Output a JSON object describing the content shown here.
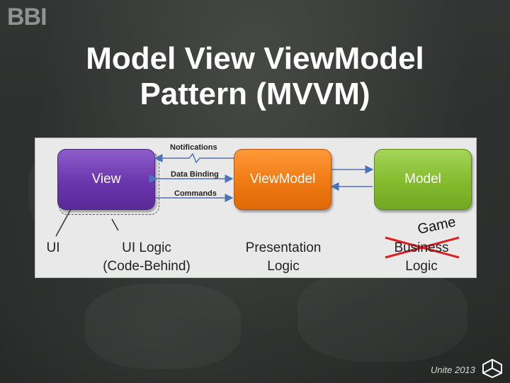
{
  "logo": {
    "text": "BBI"
  },
  "title": {
    "line1": "Model View ViewModel",
    "line2": "Pattern (MVVM)"
  },
  "diagram": {
    "boxes": {
      "view": "View",
      "viewmodel": "ViewModel",
      "model": "Model"
    },
    "arrows": {
      "notifications": "Notifications",
      "data_binding": "Data Binding",
      "commands": "Commands"
    },
    "labels": {
      "ui": "UI",
      "ui_logic_1": "UI Logic",
      "ui_logic_2": "(Code-Behind)",
      "presentation_1": "Presentation",
      "presentation_2": "Logic",
      "business_1": "Business",
      "business_2": "Logic",
      "game": "Game"
    },
    "colors": {
      "view": "#6a36ad",
      "viewmodel": "#f07a12",
      "model": "#84bb2d",
      "arrow": "#4a74b5",
      "strike": "#e02020"
    }
  },
  "footer": {
    "event": "Unite 2013",
    "icon": "unity-logo-icon"
  }
}
